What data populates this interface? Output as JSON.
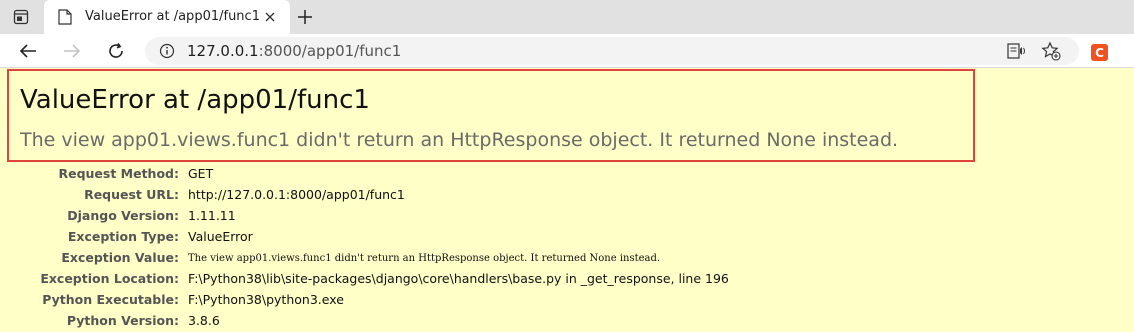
{
  "browser": {
    "tab": {
      "title": "ValueError at /app01/func1"
    },
    "address": {
      "host": "127.0.0.1",
      "rest": ":8000/app01/func1"
    },
    "extension_letter": "C",
    "accent": "#f0511e"
  },
  "page": {
    "title": "ValueError at /app01/func1",
    "subtitle": "The view app01.views.func1 didn't return an HttpResponse object. It returned None instead.",
    "background": "#ffffc8",
    "highlight_color": "#e0443a",
    "meta": [
      {
        "label": "Request Method:",
        "value": "GET"
      },
      {
        "label": "Request URL:",
        "value": "http://127.0.0.1:8000/app01/func1"
      },
      {
        "label": "Django Version:",
        "value": "1.11.11"
      },
      {
        "label": "Exception Type:",
        "value": "ValueError"
      },
      {
        "label": "Exception Value:",
        "value": "The view app01.views.func1 didn't return an HttpResponse object. It returned None instead."
      },
      {
        "label": "Exception Location:",
        "value": "F:\\Python38\\lib\\site-packages\\django\\core\\handlers\\base.py in _get_response, line 196"
      },
      {
        "label": "Python Executable:",
        "value": "F:\\Python38\\python3.exe"
      },
      {
        "label": "Python Version:",
        "value": "3.8.6"
      }
    ]
  },
  "icons": [
    "tab-actions-icon",
    "page-favicon-icon",
    "close-icon",
    "plus-icon",
    "back-arrow-icon",
    "forward-arrow-icon",
    "refresh-icon",
    "info-icon",
    "reader-view-icon",
    "add-favorite-icon"
  ]
}
